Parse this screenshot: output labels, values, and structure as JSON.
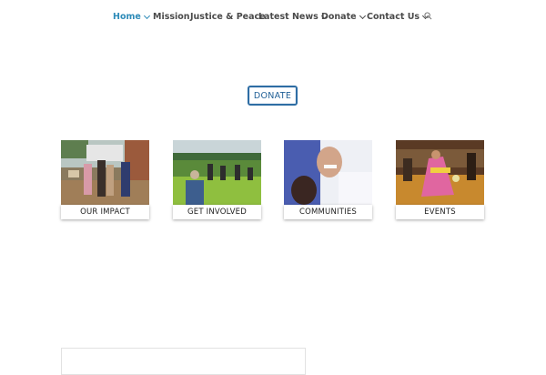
{
  "nav": {
    "items": [
      {
        "label": "Home",
        "dropdown": true,
        "active": true
      },
      {
        "label": "Mission",
        "dropdown": false,
        "active": false
      },
      {
        "label": "Justice & Peace",
        "dropdown": false,
        "active": false
      },
      {
        "label": "Latest News",
        "dropdown": true,
        "active": false
      },
      {
        "label": "Donate",
        "dropdown": true,
        "active": false
      },
      {
        "label": "Contact Us",
        "dropdown": true,
        "active": false
      }
    ],
    "search_icon": "search-icon"
  },
  "donate_button": {
    "label": "DONATE"
  },
  "cards": [
    {
      "label": "OUR IMPACT"
    },
    {
      "label": "GET INVOLVED"
    },
    {
      "label": "COMMUNITIES"
    },
    {
      "label": "EVENTS"
    }
  ],
  "colors": {
    "nav_active": "#2e8bb8",
    "nav_text": "#4a4a4a",
    "button_border": "#2e6da4",
    "button_text": "#1f5f96"
  }
}
